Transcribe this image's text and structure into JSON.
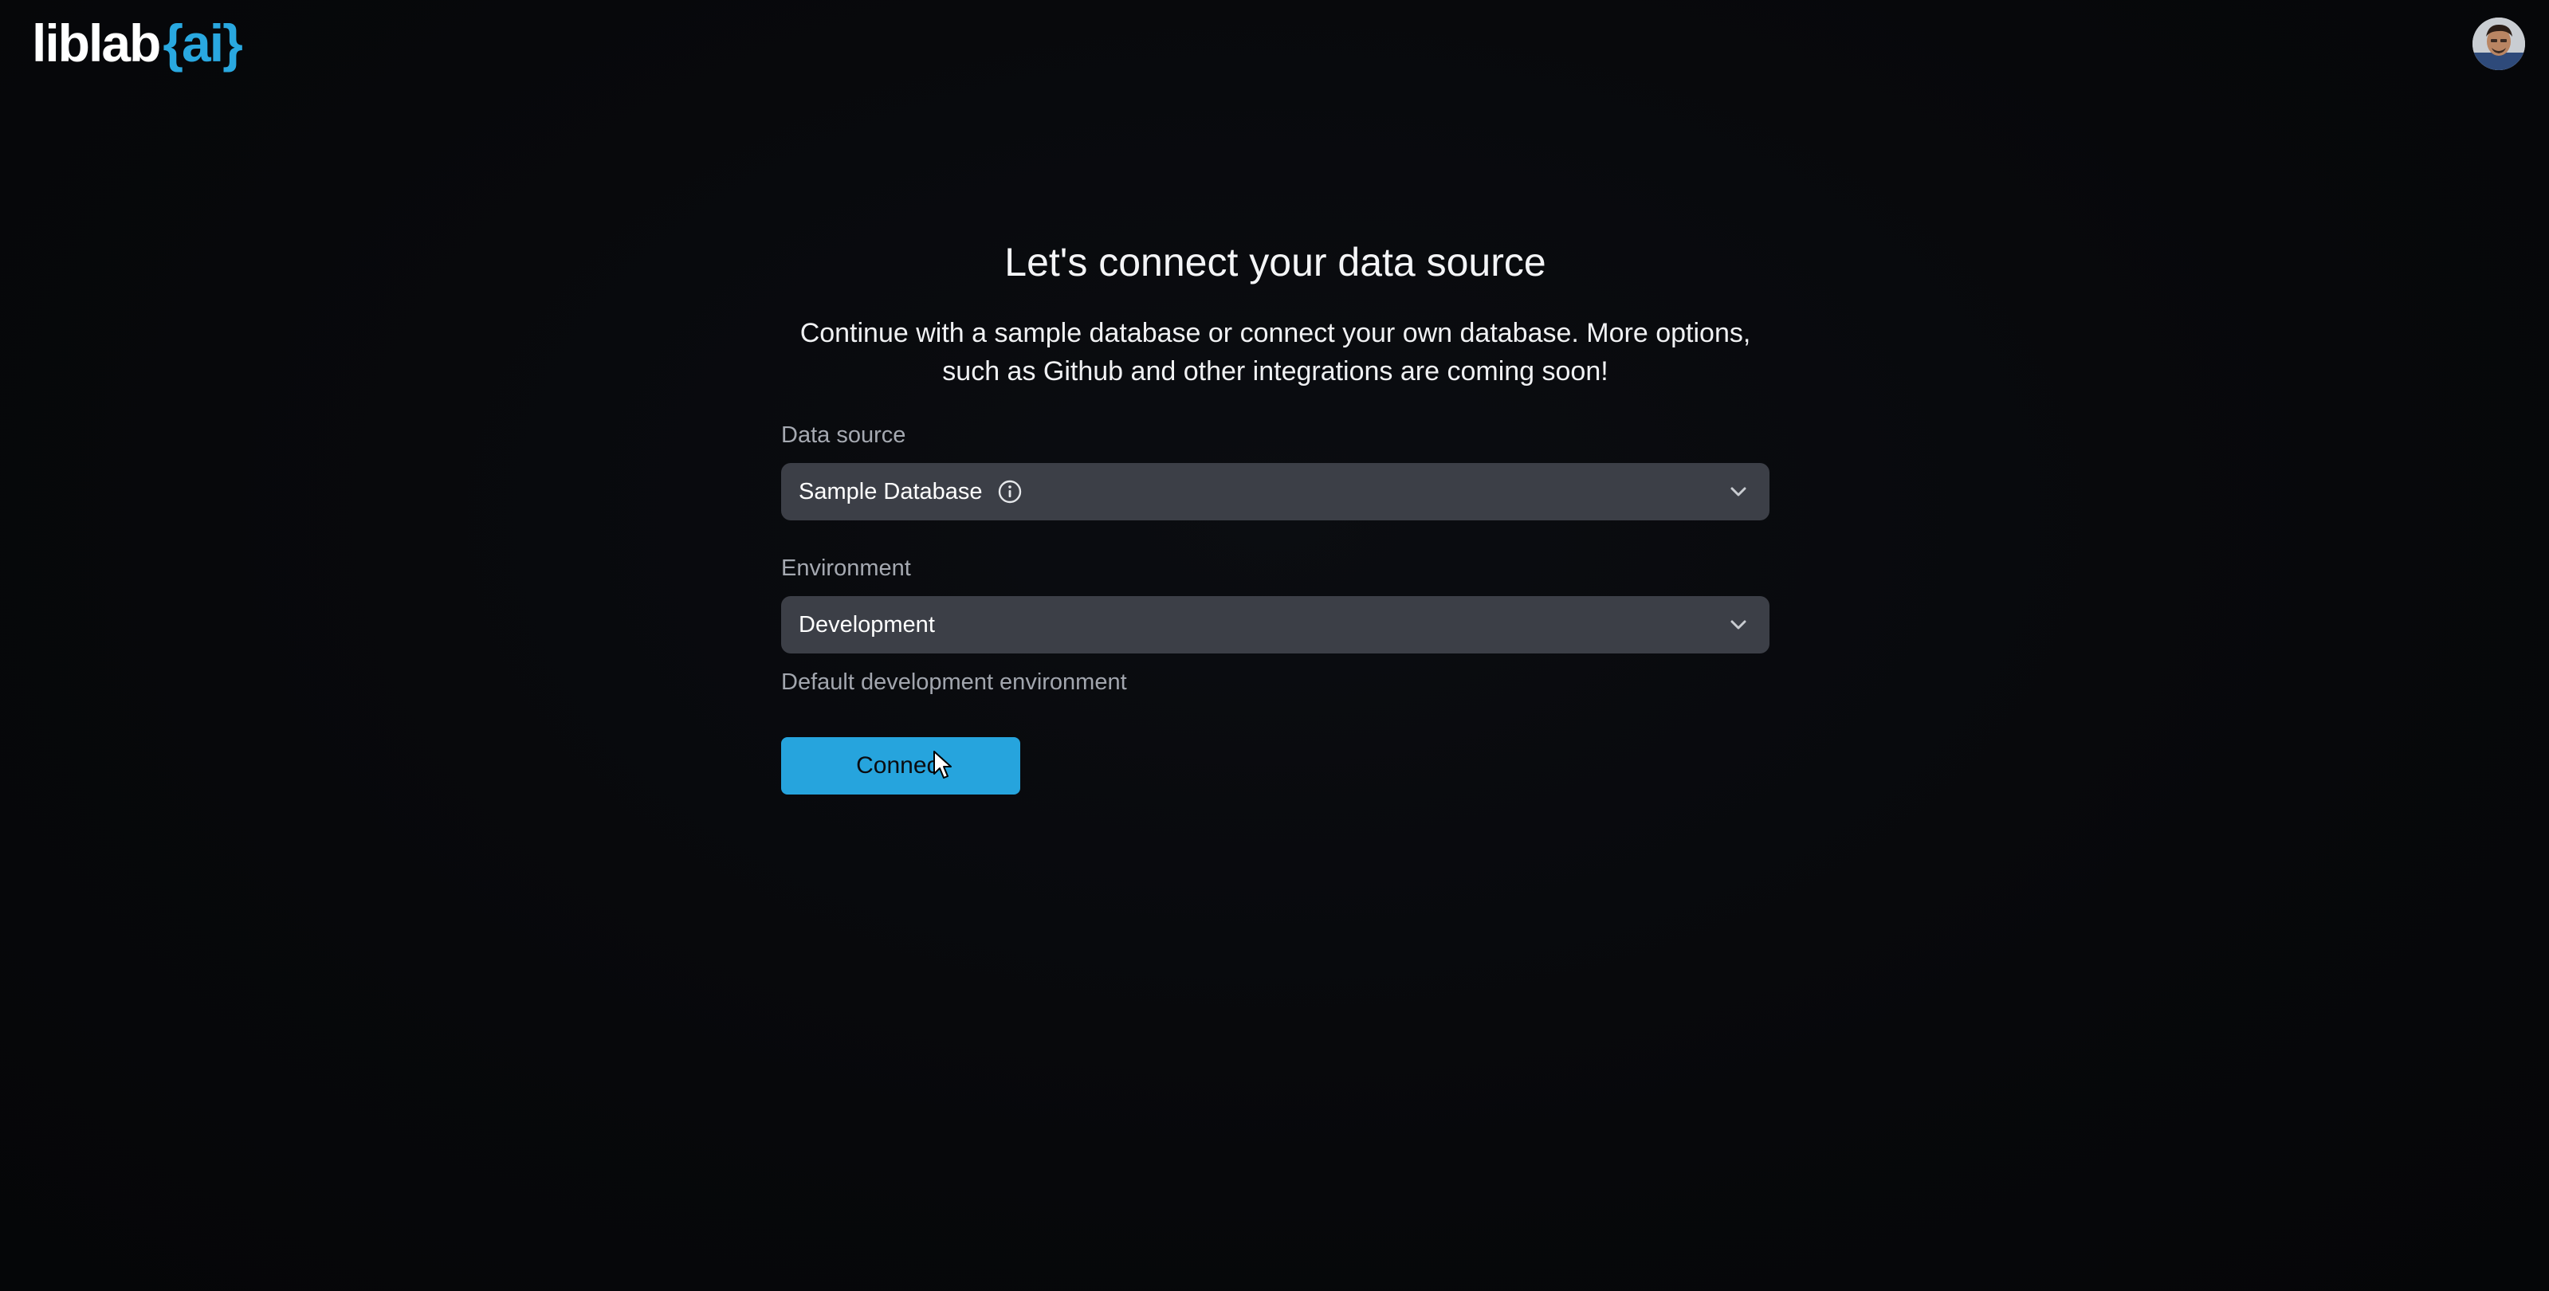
{
  "header": {
    "logo_main": "liblab",
    "logo_accent": "{ai}",
    "avatar_icon": "user-avatar-icon"
  },
  "main": {
    "title": "Let's connect your data source",
    "subtitle_line1": "Continue with a sample database or connect your own database. More options,",
    "subtitle_line2": "such as Github and other integrations are coming soon!",
    "data_source": {
      "label": "Data source",
      "value": "Sample Database",
      "info_icon": "info-icon",
      "chevron_icon": "chevron-down-icon"
    },
    "environment": {
      "label": "Environment",
      "value": "Development",
      "helper": "Default development environment",
      "chevron_icon": "chevron-down-icon"
    },
    "connect_label": "Connect"
  },
  "colors": {
    "background": "#07080b",
    "accent": "#26a4dd",
    "select_bg": "#3c3f47",
    "muted_text": "#a5a9b1"
  }
}
